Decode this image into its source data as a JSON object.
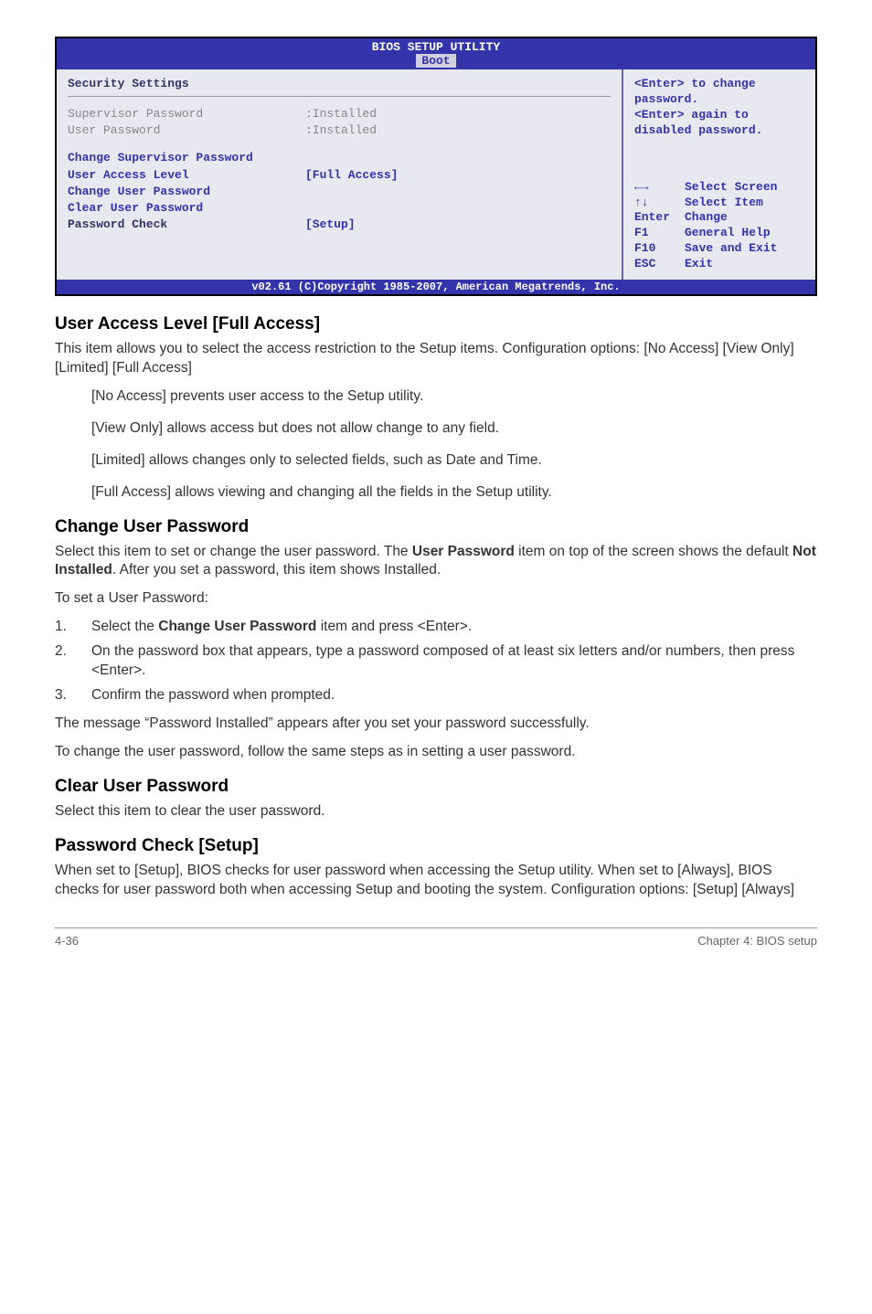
{
  "bios": {
    "title": "BIOS SETUP UTILITY",
    "tab": "Boot",
    "section_title": "Security Settings",
    "rows_gray": [
      {
        "label": "Supervisor Password",
        "value": ":Installed"
      },
      {
        "label": "User Password",
        "value": ":Installed"
      }
    ],
    "rows_blue": [
      {
        "label": "Change Supervisor Password",
        "value": ""
      },
      {
        "label": "User Access Level",
        "value": "[Full Access]"
      },
      {
        "label": "Change User Password",
        "value": ""
      },
      {
        "label": "Clear User Password",
        "value": ""
      },
      {
        "label": "Password Check",
        "value": "[Setup]"
      }
    ],
    "hint_l1": "<Enter> to change",
    "hint_l2": "password.",
    "hint_l3": "<Enter> again to",
    "hint_l4": "disabled password.",
    "nav": [
      {
        "key": "←→",
        "label": "Select Screen"
      },
      {
        "key": "↑↓",
        "label": "Select Item"
      },
      {
        "key": "Enter",
        "label": "Change"
      },
      {
        "key": "F1",
        "label": "General Help"
      },
      {
        "key": "F10",
        "label": "Save and Exit"
      },
      {
        "key": "ESC",
        "label": "Exit"
      }
    ],
    "copyright": "v02.61 (C)Copyright 1985-2007, American Megatrends, Inc."
  },
  "sections": {
    "ual_h": "User Access Level [Full Access]",
    "ual_p1": "This item allows you to select the access restriction to the Setup items. Configuration options: [No Access] [View Only] [Limited] [Full Access]",
    "ual_i1": "[No Access] prevents user access to the Setup utility.",
    "ual_i2": "[View Only] allows access but does not allow change to any field.",
    "ual_i3": "[Limited] allows changes only to selected fields, such as Date and Time.",
    "ual_i4": "[Full Access] allows viewing and changing all the fields in the Setup utility.",
    "cup_h": "Change User Password",
    "cup_p1a": "Select this item to set or change the user password. The ",
    "cup_p1b": "User Password",
    "cup_p1c": " item on top of the screen shows the default ",
    "cup_p1d": "Not Installed",
    "cup_p1e": ". After you set a password, this item shows Installed.",
    "cup_p2": "To set a User Password:",
    "cup_s1a": "Select the ",
    "cup_s1b": "Change User Password",
    "cup_s1c": " item and press <Enter>.",
    "cup_s2": "On the password box that appears, type a password composed of at least six letters and/or numbers, then press <Enter>.",
    "cup_s3": "Confirm the password when prompted.",
    "cup_p3": "The message “Password Installed” appears after you set your password successfully.",
    "cup_p4": "To change the user password, follow the same steps as in setting a user password.",
    "clr_h": "Clear User Password",
    "clr_p1": "Select this item to clear the user password.",
    "pc_h": "Password Check [Setup]",
    "pc_p1": "When set to [Setup], BIOS checks for user password when accessing the Setup utility. When set to [Always], BIOS checks for user password both when accessing Setup and booting the system. Configuration options: [Setup] [Always]"
  },
  "footer": {
    "page": "4-36",
    "chapter": "Chapter 4: BIOS setup"
  }
}
